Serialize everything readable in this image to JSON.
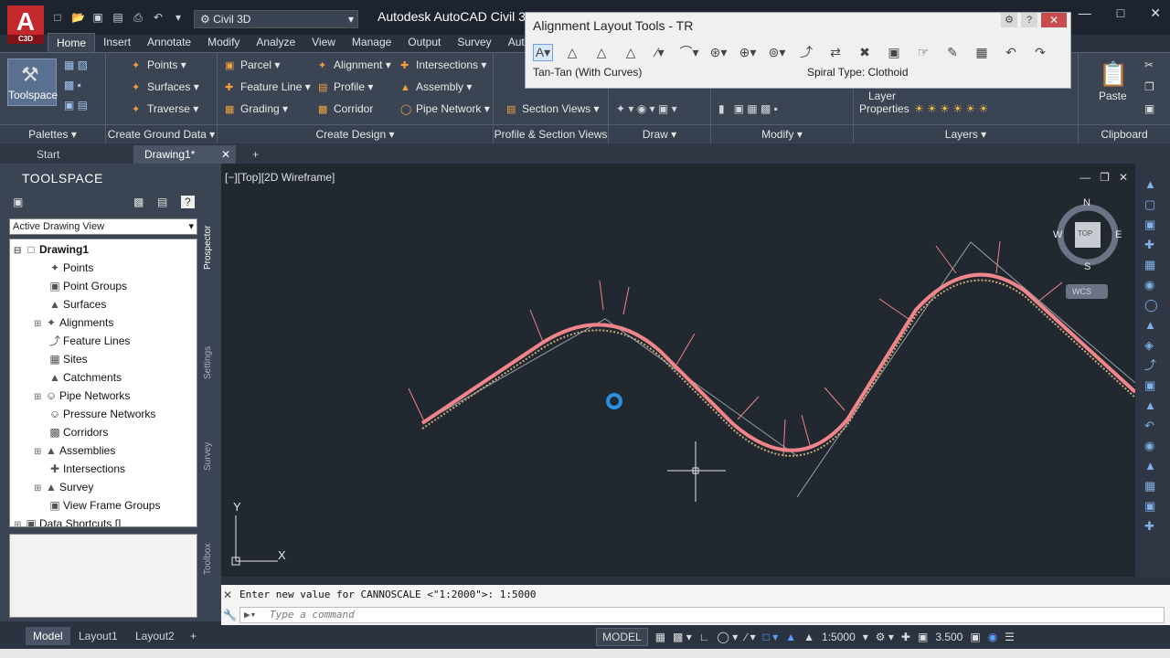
{
  "app": {
    "logo_letter": "A",
    "logo_sub": "C3D",
    "workspace": "Civil 3D",
    "title": "Autodesk AutoCAD Civil 3"
  },
  "ribbon_tabs": [
    "Home",
    "Insert",
    "Annotate",
    "Modify",
    "Analyze",
    "View",
    "Manage",
    "Output",
    "Survey",
    "Autod"
  ],
  "ribbon": {
    "toolspace_label": "Toolspace",
    "palettes": "Palettes",
    "ground": {
      "points": "Points",
      "surfaces": "Surfaces",
      "traverse": "Traverse",
      "title": "Create Ground Data"
    },
    "design": {
      "parcel": "Parcel",
      "feature_line": "Feature Line",
      "grading": "Grading",
      "alignment": "Alignment",
      "profile": "Profile",
      "corridor": "Corridor",
      "intersections": "Intersections",
      "assembly": "Assembly",
      "pipe_network": "Pipe Network",
      "title": "Create Design"
    },
    "section_views": "Section Views",
    "profile_section_title": "Profile & Section Views",
    "draw_title": "Draw",
    "modify_title": "Modify",
    "layer_properties": "Layer Properties",
    "layers_title": "Layers",
    "paste": "Paste",
    "clipboard_title": "Clipboard"
  },
  "palette": {
    "title": "Alignment Layout Tools - TR",
    "mode": "Tan-Tan (With Curves)",
    "spiral": "Spiral Type: Clothoid"
  },
  "doc_tabs": {
    "start": "Start",
    "drawing": "Drawing1*"
  },
  "toolspace": {
    "title": "TOOLSPACE",
    "view": "Active Drawing View",
    "root": "Drawing1",
    "items": [
      "Points",
      "Point Groups",
      "Surfaces",
      "Alignments",
      "Feature Lines",
      "Sites",
      "Catchments",
      "Pipe Networks",
      "Pressure Networks",
      "Corridors",
      "Assemblies",
      "Intersections",
      "Survey",
      "View Frame Groups"
    ],
    "data_shortcuts": "Data Shortcuts []",
    "side_tabs": [
      "Prospector",
      "Settings",
      "Survey",
      "Toolbox"
    ]
  },
  "viewport": {
    "label": "[−][Top][2D Wireframe]",
    "compass": {
      "n": "N",
      "s": "S",
      "e": "E",
      "w": "W",
      "top": "TOP",
      "wcs": "WCS"
    },
    "ucs_x": "X",
    "ucs_y": "Y"
  },
  "command": {
    "history": "Enter new value for CANNOSCALE <\"1:2000\">: 1:5000",
    "placeholder": "Type a command"
  },
  "layout_tabs": [
    "Model",
    "Layout1",
    "Layout2"
  ],
  "status": {
    "model": "MODEL",
    "scale": "1:5000",
    "value": "3.500"
  },
  "colors": {
    "alignment": "#f0858a",
    "viewport_bg": "#212830",
    "ribbon_bg": "#3b4453"
  }
}
